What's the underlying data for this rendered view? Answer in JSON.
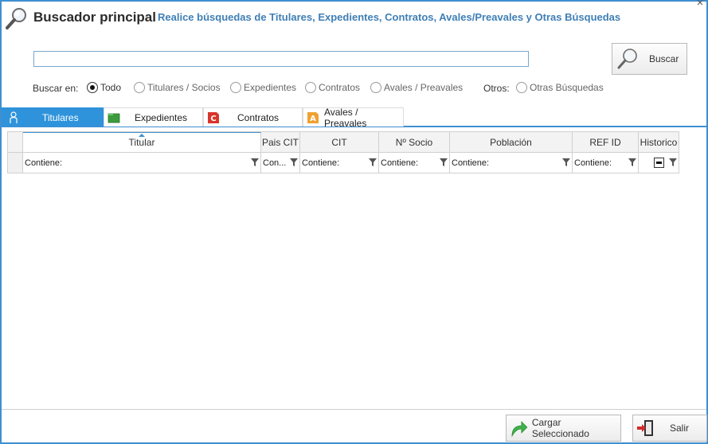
{
  "header": {
    "title": "Buscador principal",
    "subtitle": "Realice búsquedas de Titulares, Expedientes, Contratos, Avales/Preavales y Otras Búsquedas"
  },
  "search": {
    "value": "",
    "placeholder": "",
    "button_label": "Buscar"
  },
  "scope": {
    "label": "Buscar en:",
    "options": [
      {
        "label": "Todo",
        "selected": true
      },
      {
        "label": "Titulares / Socios",
        "selected": false
      },
      {
        "label": "Expedientes",
        "selected": false
      },
      {
        "label": "Contratos",
        "selected": false
      },
      {
        "label": "Avales / Preavales",
        "selected": false
      }
    ],
    "others_label": "Otros:",
    "others_option": {
      "label": "Otras Búsquedas",
      "selected": false
    }
  },
  "tabs": [
    {
      "label": "Titulares",
      "icon": "person-icon",
      "active": true
    },
    {
      "label": "Expedientes",
      "icon": "folder-icon",
      "active": false
    },
    {
      "label": "Contratos",
      "icon": "contract-icon",
      "active": false
    },
    {
      "label": "Avales / Preavales",
      "icon": "aval-icon",
      "active": false
    }
  ],
  "grid": {
    "columns": [
      "Titular",
      "Pais CIT",
      "CIT",
      "Nº Socio",
      "Población",
      "REF ID",
      "Historico"
    ],
    "filters": [
      "Contiene:",
      "Con...",
      "Contiene:",
      "Contiene:",
      "Contiene:",
      "Contiene:",
      ""
    ],
    "rows": []
  },
  "footer": {
    "load_label": "Cargar Seleccionado",
    "exit_label": "Salir"
  },
  "colors": {
    "accent": "#2f93db",
    "border": "#3f8fd0",
    "subtitle": "#3f7fb5"
  }
}
